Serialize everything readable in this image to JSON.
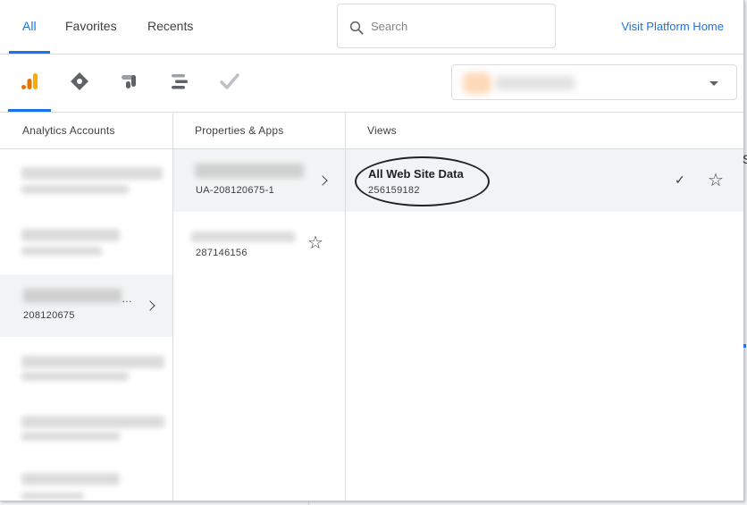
{
  "tabs": [
    {
      "label": "All",
      "active": true
    },
    {
      "label": "Favorites",
      "active": false
    },
    {
      "label": "Recents",
      "active": false
    }
  ],
  "search": {
    "placeholder": "Search",
    "value": ""
  },
  "visit_link": "Visit Platform Home",
  "products": [
    {
      "icon": "analytics-icon",
      "active": true
    },
    {
      "icon": "tag-manager-icon",
      "active": false
    },
    {
      "icon": "data-studio-icon",
      "active": false
    },
    {
      "icon": "optimize-icon",
      "active": false
    },
    {
      "icon": "surveys-icon",
      "active": false
    }
  ],
  "columns": {
    "accounts": {
      "header": "Analytics Accounts",
      "selected": {
        "name_ellipsis": "…",
        "id": "208120675"
      }
    },
    "properties": {
      "header": "Properties & Apps",
      "items": [
        {
          "id": "UA-208120675-1",
          "selected": true
        },
        {
          "id": "287146156",
          "selected": false
        }
      ]
    },
    "views": {
      "header": "Views",
      "items": [
        {
          "name": "All Web Site Data",
          "id": "256159182",
          "selected": true,
          "check": "✓"
        }
      ]
    }
  },
  "colors": {
    "accent": "#1a73e8",
    "selected_row": "#f1f3f4",
    "analytics_orange": "#f9ab00",
    "analytics_dark": "#e37400"
  }
}
